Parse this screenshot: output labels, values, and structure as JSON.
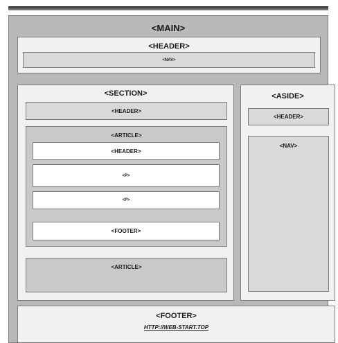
{
  "main": {
    "label": "<MAIN>"
  },
  "header_block": {
    "header_label": "<HEADER>",
    "nav_label": "<NAV>"
  },
  "section": {
    "label": "<SECTION>",
    "header_label": "<HEADER>",
    "article": {
      "label": "<ARTICLE>",
      "header_label": "<HEADER>",
      "p1_label": "<P>",
      "p2_label": "<P>",
      "footer_label": "<FOOTER>"
    },
    "article2_label": "<ARTICLE>"
  },
  "aside": {
    "label": "<ASIDE>",
    "header_label": "<HEADER>",
    "nav_label": "<NAV>"
  },
  "footer_block": {
    "label": "<FOOTER>",
    "link": "HTTP://WEB-START.TOP"
  }
}
